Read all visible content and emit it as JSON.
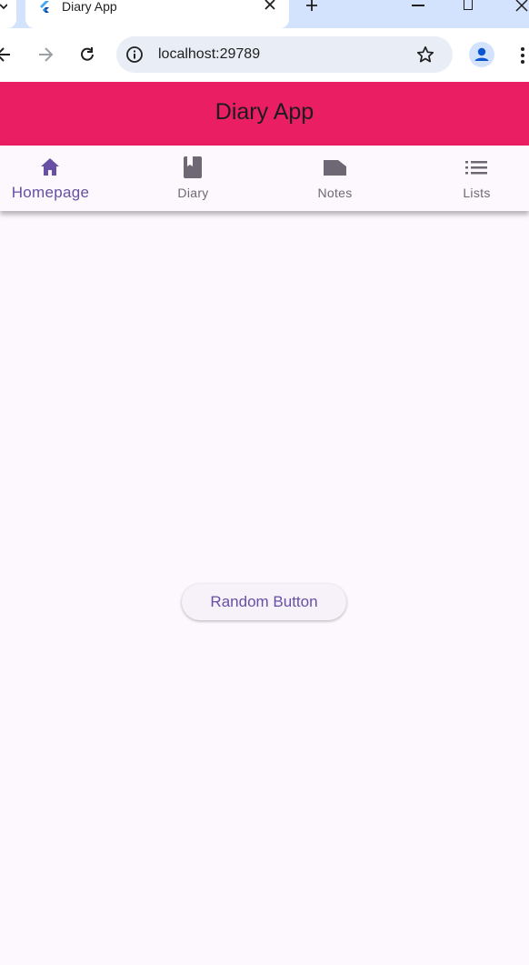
{
  "browser": {
    "tab": {
      "title": "Diary App",
      "favicon": "flutter-icon"
    },
    "toolbar": {
      "url": "localhost:29789",
      "icons": [
        "back-arrow-icon",
        "forward-arrow-icon",
        "reload-icon",
        "site-info-icon",
        "bookmark-star-icon",
        "profile-icon",
        "more-vert-icon"
      ]
    }
  },
  "app": {
    "title": "Diary App",
    "colors": {
      "app_bar": "#e91e63",
      "background": "#fdf7fe",
      "accent": "#6750a4",
      "inactive": "#6e6874"
    },
    "nav": {
      "active_index": 0,
      "items": [
        {
          "label": "Homepage",
          "icon": "home-icon"
        },
        {
          "label": "Diary",
          "icon": "book-icon"
        },
        {
          "label": "Notes",
          "icon": "label-icon"
        },
        {
          "label": "Lists",
          "icon": "list-icon"
        }
      ]
    },
    "main": {
      "button_label": "Random Button"
    }
  }
}
